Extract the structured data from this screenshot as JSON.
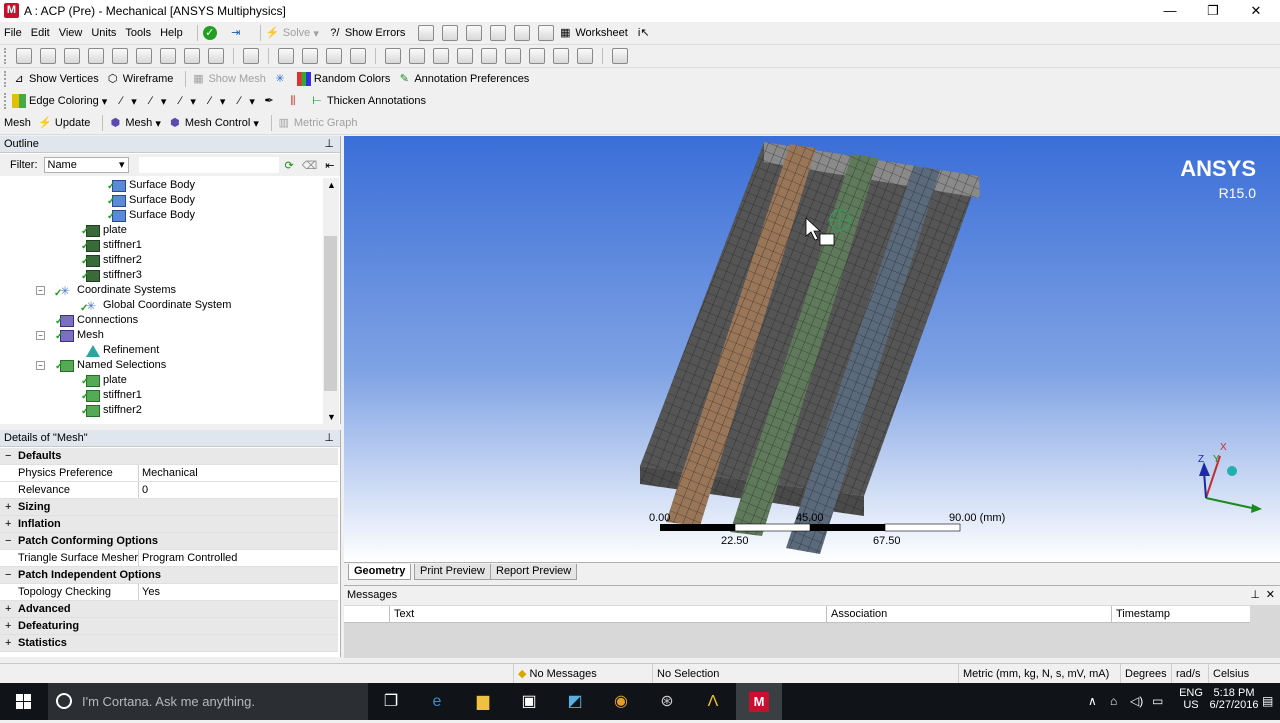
{
  "window": {
    "title": "A : ACP (Pre) - Mechanical [ANSYS Multiphysics]",
    "min": "—",
    "max": "❐",
    "close": "✕"
  },
  "menu": [
    "File",
    "Edit",
    "View",
    "Units",
    "Tools",
    "Help"
  ],
  "toolbar1": {
    "solve": "Solve",
    "show_errors": "Show Errors",
    "worksheet": "Worksheet"
  },
  "toolbar3": {
    "show_vertices": "Show Vertices",
    "wireframe": "Wireframe",
    "show_mesh": "Show Mesh",
    "random_colors": "Random Colors",
    "annotation_prefs": "Annotation Preferences"
  },
  "toolbar4": {
    "edge_coloring": "Edge Coloring",
    "thicken": "Thicken Annotations"
  },
  "toolbar5": {
    "mesh": "Mesh",
    "update": "Update",
    "mesh_menu": "Mesh",
    "mesh_control": "Mesh Control",
    "metric_graph": "Metric Graph"
  },
  "outline": {
    "title": "Outline",
    "filter_label": "Filter:",
    "filter_value": "Name",
    "items": [
      {
        "label": "Surface Body",
        "level": 3,
        "icon": "body"
      },
      {
        "label": "Surface Body",
        "level": 3,
        "icon": "body"
      },
      {
        "label": "Surface Body",
        "level": 3,
        "icon": "body"
      },
      {
        "label": "plate",
        "level": 2,
        "icon": "part"
      },
      {
        "label": "stiffner1",
        "level": 2,
        "icon": "part"
      },
      {
        "label": "stiffner2",
        "level": 2,
        "icon": "part"
      },
      {
        "label": "stiffner3",
        "level": 2,
        "icon": "part"
      },
      {
        "label": "Coordinate Systems",
        "level": 1,
        "icon": "cs"
      },
      {
        "label": "Global Coordinate System",
        "level": 2,
        "icon": "cs"
      },
      {
        "label": "Connections",
        "level": 1,
        "icon": "mesh"
      },
      {
        "label": "Mesh",
        "level": 1,
        "icon": "mesh"
      },
      {
        "label": "Refinement",
        "level": 2,
        "icon": "ref"
      },
      {
        "label": "Named Selections",
        "level": 1,
        "icon": "ns"
      },
      {
        "label": "plate",
        "level": 2,
        "icon": "ns"
      },
      {
        "label": "stiffner1",
        "level": 2,
        "icon": "ns"
      },
      {
        "label": "stiffner2",
        "level": 2,
        "icon": "ns"
      }
    ]
  },
  "details": {
    "title": "Details of \"Mesh\"",
    "rows": [
      {
        "type": "group",
        "pm": "−",
        "label": "Defaults"
      },
      {
        "type": "prop",
        "label": "Physics Preference",
        "value": "Mechanical"
      },
      {
        "type": "prop",
        "label": "Relevance",
        "value": "0"
      },
      {
        "type": "group",
        "pm": "+",
        "label": "Sizing"
      },
      {
        "type": "group",
        "pm": "+",
        "label": "Inflation"
      },
      {
        "type": "group",
        "pm": "−",
        "label": "Patch Conforming Options"
      },
      {
        "type": "prop",
        "label": "Triangle Surface Mesher",
        "value": "Program Controlled"
      },
      {
        "type": "group",
        "pm": "−",
        "label": "Patch Independent Options"
      },
      {
        "type": "prop",
        "label": "Topology Checking",
        "value": "Yes"
      },
      {
        "type": "group",
        "pm": "+",
        "label": "Advanced"
      },
      {
        "type": "group",
        "pm": "+",
        "label": "Defeaturing"
      },
      {
        "type": "group",
        "pm": "+",
        "label": "Statistics"
      }
    ]
  },
  "viewport": {
    "brand": "ANSYS",
    "version": "R15.0",
    "scale": {
      "t0": "0.00",
      "t1": "45.00",
      "t2": "90.00 (mm)",
      "t3": "22.50",
      "t4": "67.50"
    },
    "triad": {
      "x": "X",
      "y": "Y",
      "z": "Z"
    }
  },
  "tabs": [
    "Geometry",
    "Print Preview",
    "Report Preview"
  ],
  "messages": {
    "title": "Messages",
    "cols": [
      "Text",
      "Association",
      "Timestamp"
    ]
  },
  "status": {
    "messages": "No Messages",
    "selection": "No Selection",
    "units": "Metric (mm, kg, N, s, mV, mA)",
    "degrees": "Degrees",
    "rads": "rad/s",
    "temp": "Celsius"
  },
  "taskbar": {
    "cortana": "I'm Cortana. Ask me anything.",
    "lang": "ENG",
    "region": "US",
    "time": "5:18 PM",
    "date": "6/27/2016"
  }
}
